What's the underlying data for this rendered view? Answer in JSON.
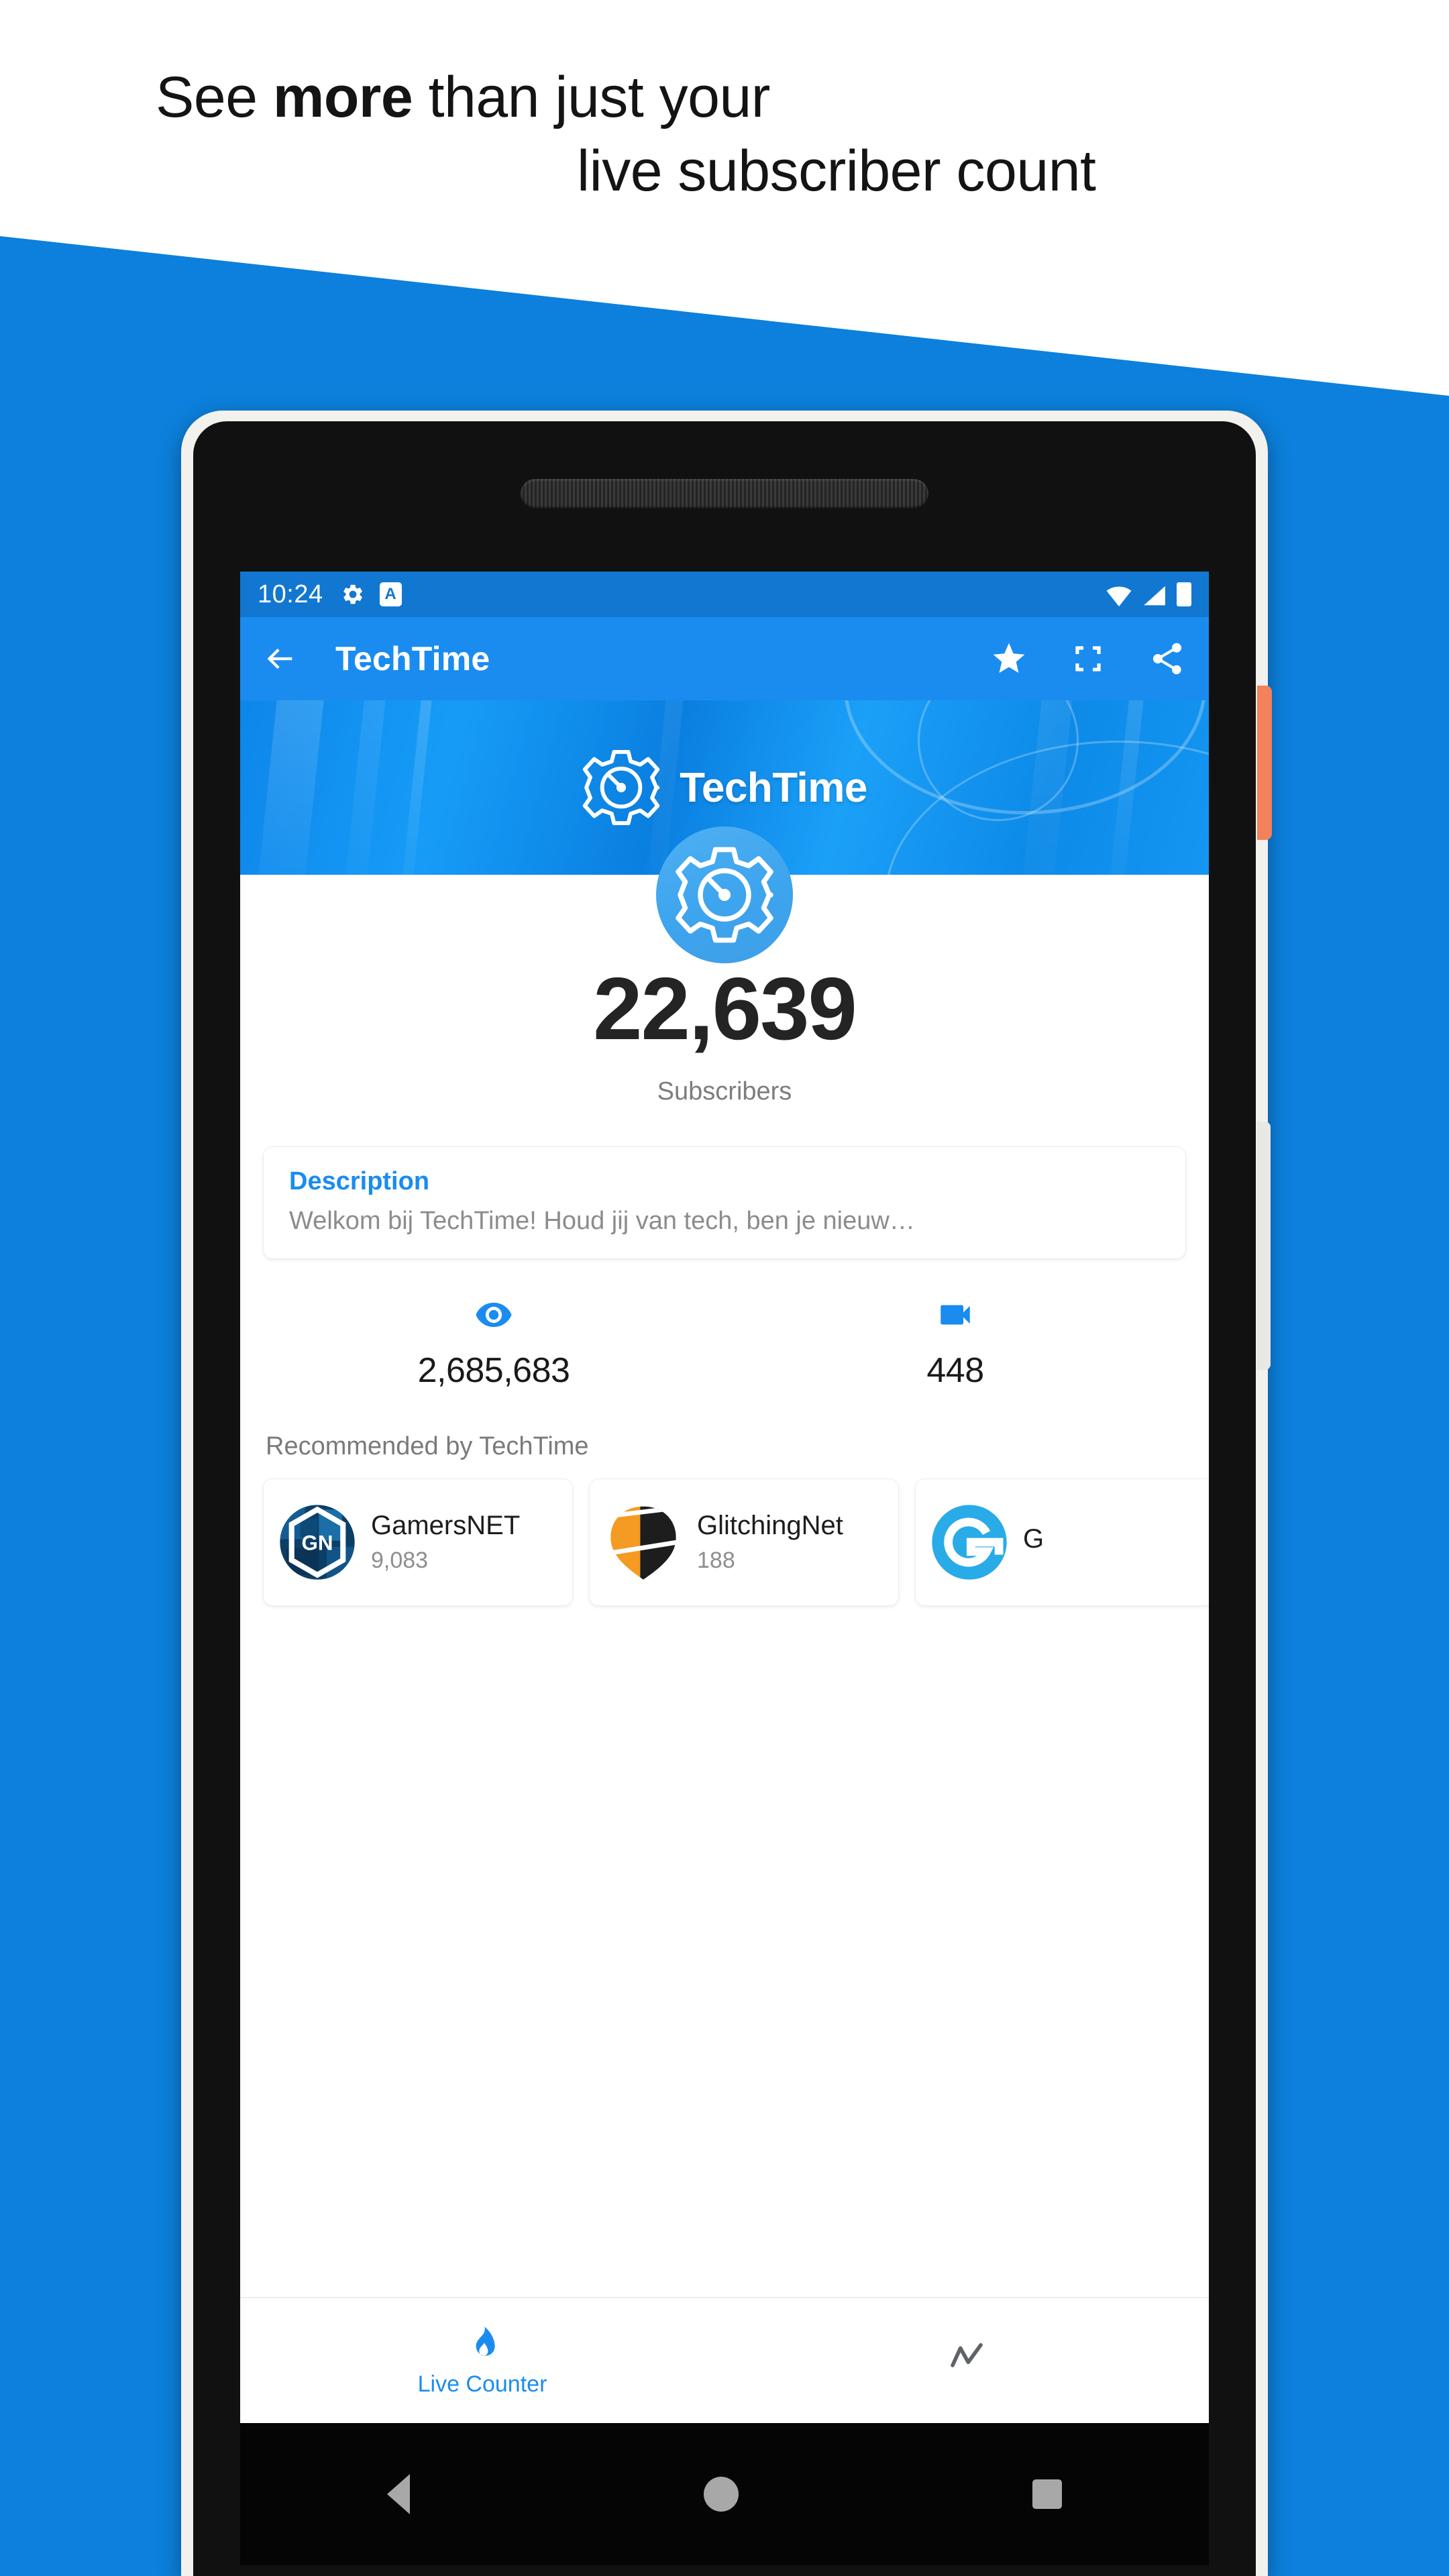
{
  "promo": {
    "line1_prefix": "See ",
    "line1_strong": "more",
    "line1_suffix": " than just your",
    "line2": "live subscriber count",
    "background_color": "#0c80dc"
  },
  "status_bar": {
    "time": "10:24",
    "icons": [
      "gear-icon",
      "keyboard-language-icon",
      "wifi-icon",
      "signal-icon",
      "battery-icon"
    ],
    "background_color": "#1177d1"
  },
  "app_bar": {
    "back_label": "Back",
    "title": "TechTime",
    "actions": [
      "favorite-star",
      "fullscreen",
      "share"
    ],
    "background_color": "#1a8cf0"
  },
  "banner": {
    "channel_name": "TechTime",
    "logo": "gear-speedometer-icon"
  },
  "avatar": {
    "icon": "gear-speedometer-icon"
  },
  "channel": {
    "subscriber_count": "22,639",
    "subscriber_label": "Subscribers"
  },
  "description": {
    "title": "Description",
    "body": "Welkom bij TechTime!  Houd jij van tech, ben je nieuw…",
    "title_color": "#1a8cf0"
  },
  "stats": [
    {
      "icon": "eye-icon",
      "value": "2,685,683",
      "name": "views"
    },
    {
      "icon": "video-camera-icon",
      "value": "448",
      "name": "videos"
    }
  ],
  "recommended": {
    "title": "Recommended by TechTime",
    "items": [
      {
        "name": "GamersNET",
        "count": "9,083",
        "logo": "gamersnet-hexagon-logo"
      },
      {
        "name": "GlitchingNet",
        "count": "188",
        "logo": "glitchingnet-shield-logo"
      },
      {
        "name": "G",
        "count": "",
        "logo": "blue-g-circle-logo"
      }
    ]
  },
  "bottom_nav": {
    "tabs": [
      {
        "label": "Live Counter",
        "icon": "flame-icon",
        "active": true
      },
      {
        "label": "",
        "icon": "trend-line-icon",
        "active": false
      }
    ],
    "active_color": "#1a8cf0"
  },
  "android_nav": {
    "buttons": [
      "back-triangle",
      "home-circle",
      "recents-square"
    ]
  }
}
